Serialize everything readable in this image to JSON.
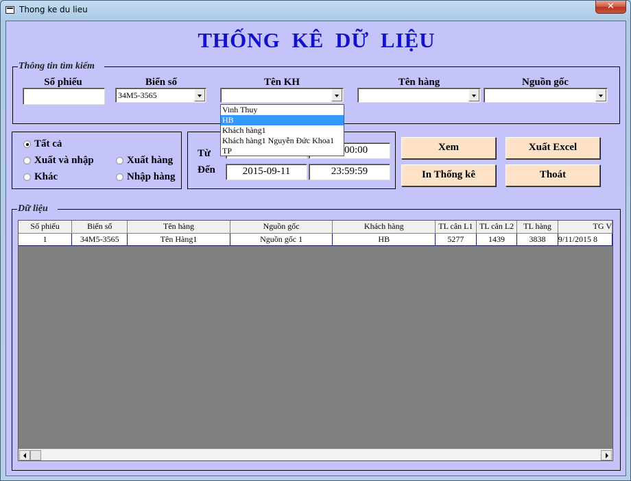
{
  "window": {
    "title": "Thong ke du lieu",
    "close_label": "✕"
  },
  "main_title": "THỐNG KÊ DỮ LIỆU",
  "search_group": {
    "label": "Thông tin tìm kiếm",
    "so_phieu": {
      "label": "Số phiếu",
      "value": ""
    },
    "bien_so": {
      "label": "Biển số",
      "value": "34M5-3565"
    },
    "ten_kh": {
      "label": "Tên KH",
      "value": "",
      "options": [
        "Vinh Thuy",
        "HB",
        "Khách hàng1",
        "Khách hàng1 Nguyễn Đức Khoa1",
        "TP"
      ],
      "highlighted_index": 1
    },
    "ten_hang": {
      "label": "Tên hàng",
      "value": ""
    },
    "nguon_goc": {
      "label": "Nguồn gốc",
      "value": ""
    }
  },
  "filter": {
    "options": [
      {
        "label": "Tất cả",
        "checked": true
      },
      {
        "label": "Xuất và nhập",
        "checked": false
      },
      {
        "label": "Xuất hàng",
        "checked": false
      },
      {
        "label": "Khác",
        "checked": false
      },
      {
        "label": "Nhập hàng",
        "checked": false
      }
    ]
  },
  "date_range": {
    "from_label": "Từ",
    "to_label": "Đến",
    "from_date": "",
    "from_time": "00:00:00",
    "to_date": "2015-09-11",
    "to_time": "23:59:59"
  },
  "buttons": {
    "xem": "Xem",
    "xuat_excel": "Xuất Excel",
    "in_thong_ke": "In Thống kê",
    "thoat": "Thoát"
  },
  "data_group": {
    "label": "Dữ liệu",
    "columns": [
      "Số phiếu",
      "Biển số",
      "Tên hàng",
      "Nguồn gốc",
      "Khách hàng",
      "TL cân L1",
      "TL cân L2",
      "TL hàng",
      "TG V"
    ],
    "rows": [
      [
        "1",
        "34M5-3565",
        "Tên Hàng1",
        "Nguồn gốc 1",
        "HB",
        "5277",
        "1439",
        "3838",
        "9/11/2015 8"
      ]
    ]
  }
}
